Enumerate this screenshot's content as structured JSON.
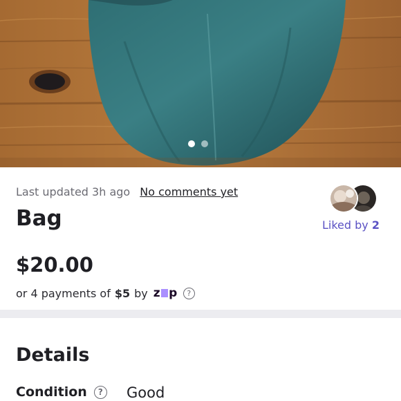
{
  "listing": {
    "last_updated": "Last updated 3h ago",
    "comments_link": "No comments yet",
    "title": "Bag",
    "price": "$20.00",
    "installments": {
      "prefix": "or 4 payments of",
      "amount": "$5",
      "by": "by",
      "provider": "zip"
    },
    "likes": {
      "label": "Liked by",
      "count": "2"
    }
  },
  "gallery": {
    "current": 1,
    "total": 2
  },
  "details": {
    "heading": "Details",
    "condition_label": "Condition",
    "condition_value": "Good"
  },
  "colors": {
    "accent": "#5b52c4",
    "zip_purple": "#aa8fff",
    "divider": "#ececf0"
  }
}
